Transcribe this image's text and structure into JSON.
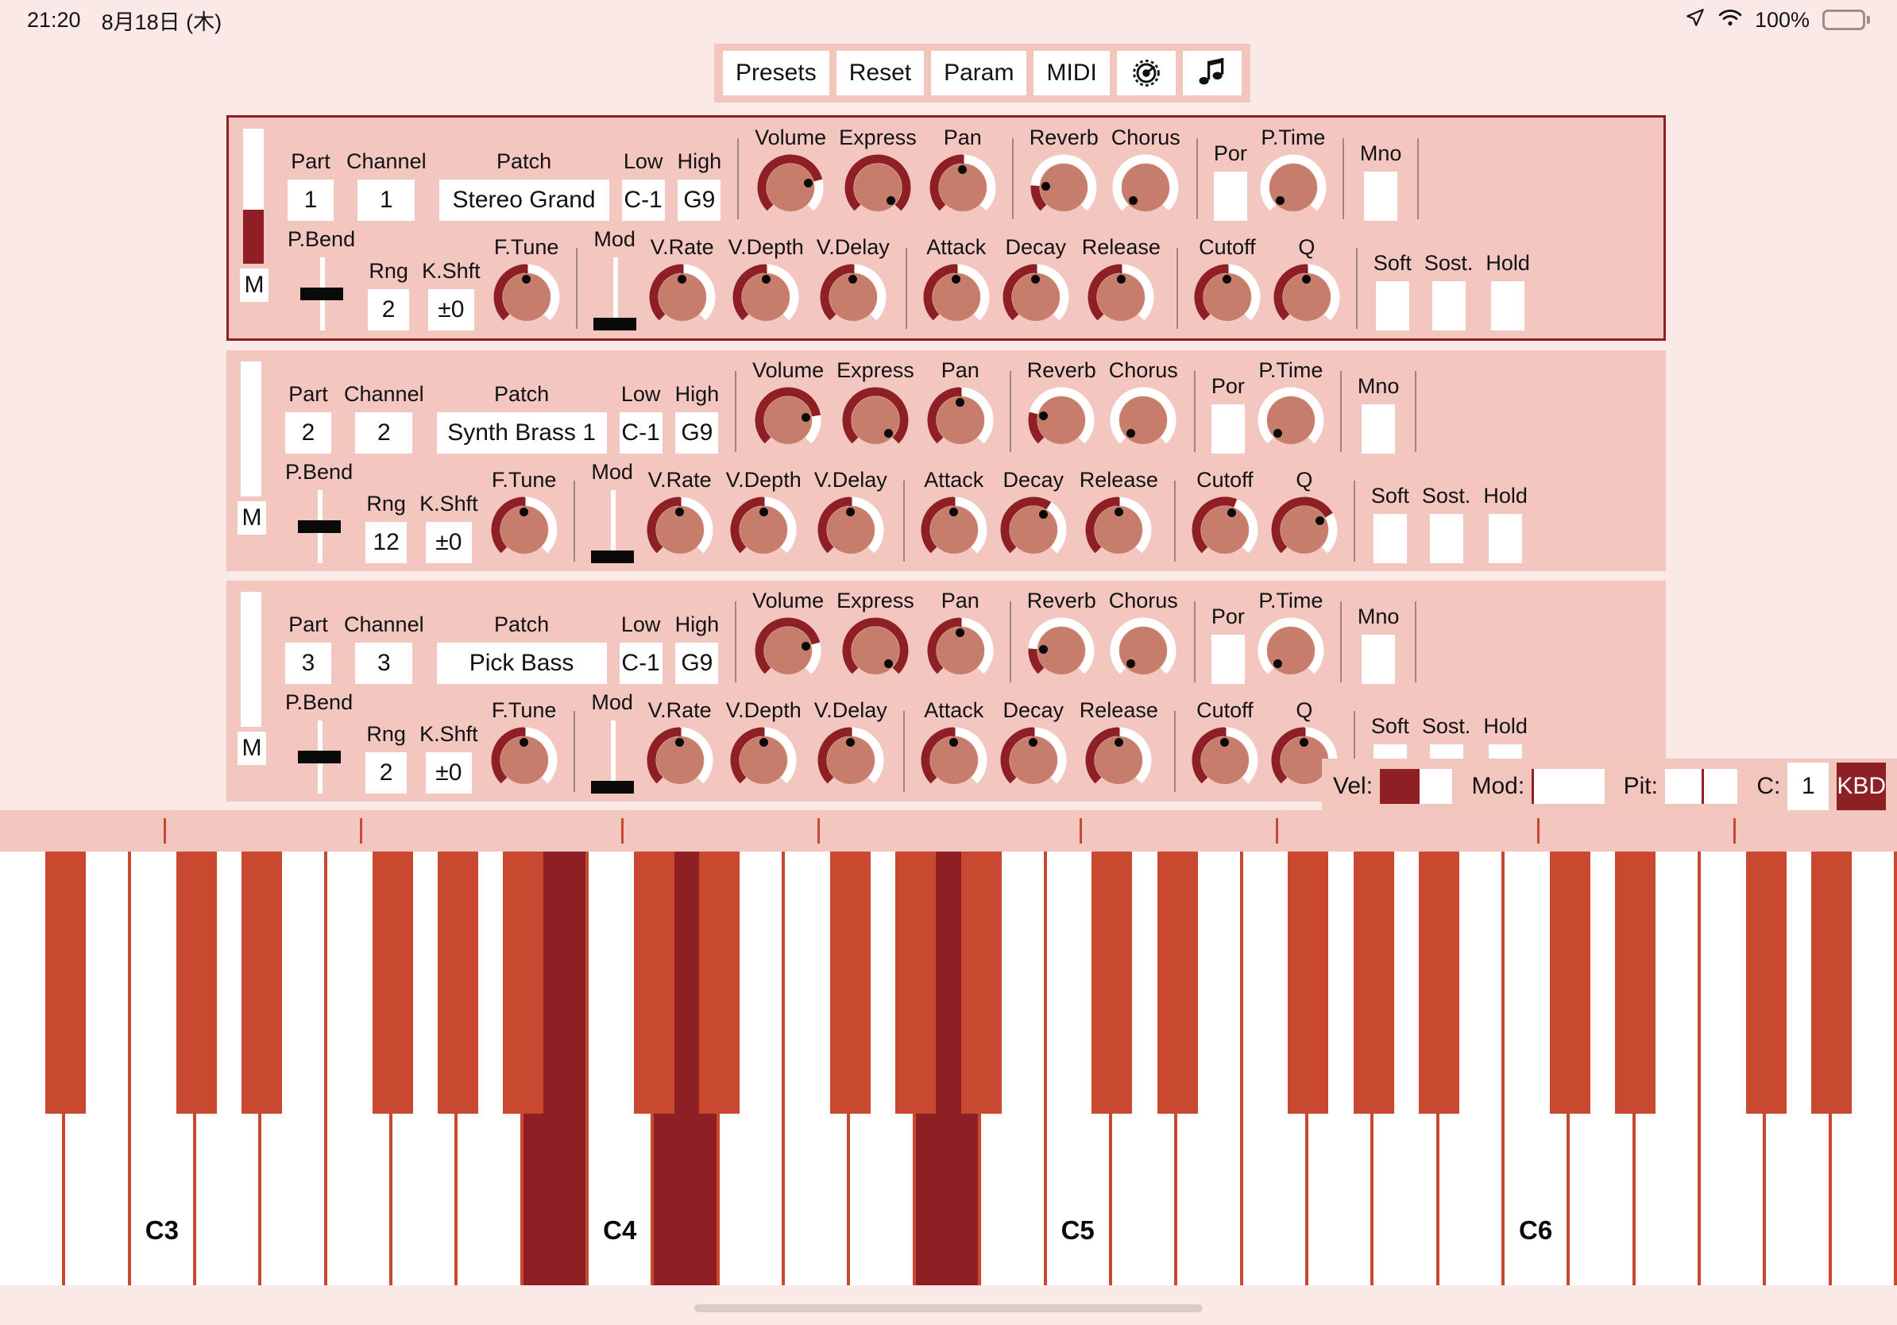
{
  "status_bar": {
    "time": "21:20",
    "date": "8月18日 (木)",
    "battery_percent": "100%",
    "icons": [
      "location-arrow-icon",
      "wifi-icon",
      "battery-icon"
    ]
  },
  "toolbar": {
    "buttons": [
      {
        "label": "Presets",
        "name": "presets-button"
      },
      {
        "label": "Reset",
        "name": "reset-button"
      },
      {
        "label": "Param",
        "name": "param-button"
      },
      {
        "label": "MIDI",
        "name": "midi-button"
      }
    ],
    "icon_buttons": [
      {
        "name": "gear-icon",
        "label": "Settings"
      },
      {
        "name": "music-note-icon",
        "label": "Sound"
      }
    ]
  },
  "labels": {
    "part": "Part",
    "channel": "Channel",
    "patch": "Patch",
    "low": "Low",
    "high": "High",
    "volume": "Volume",
    "express": "Express",
    "pan": "Pan",
    "reverb": "Reverb",
    "chorus": "Chorus",
    "por": "Por",
    "ptime": "P.Time",
    "mno": "Mno",
    "pbend": "P.Bend",
    "rng": "Rng",
    "kshft": "K.Shft",
    "ftune": "F.Tune",
    "mod": "Mod",
    "vrate": "V.Rate",
    "vdepth": "V.Depth",
    "vdelay": "V.Delay",
    "attack": "Attack",
    "decay": "Decay",
    "release": "Release",
    "cutoff": "Cutoff",
    "q": "Q",
    "soft": "Soft",
    "sost": "Sost.",
    "hold": "Hold",
    "mute": "M"
  },
  "parts": [
    {
      "selected": true,
      "meter_level": 40,
      "part": "1",
      "channel": "1",
      "patch": "Stereo Grand",
      "low": "C-1",
      "high": "G9",
      "volume": 0.78,
      "express": 1.0,
      "pan": 0.5,
      "reverb": 0.18,
      "chorus": 0.0,
      "por": false,
      "ptime": 0.0,
      "mno": false,
      "pbend": 0.5,
      "rng": "2",
      "kshft": "±0",
      "ftune": 0.5,
      "mod": 0.0,
      "vrate": 0.5,
      "vdepth": 0.5,
      "vdelay": 0.5,
      "attack": 0.5,
      "decay": 0.5,
      "release": 0.5,
      "cutoff": 0.5,
      "q": 0.5,
      "soft": false,
      "sost": false,
      "hold": false
    },
    {
      "selected": false,
      "meter_level": 0,
      "part": "2",
      "channel": "2",
      "patch": "Synth Brass 1",
      "low": "C-1",
      "high": "G9",
      "volume": 0.8,
      "express": 1.0,
      "pan": 0.5,
      "reverb": 0.22,
      "chorus": 0.0,
      "por": false,
      "ptime": 0.0,
      "mno": false,
      "pbend": 0.5,
      "rng": "12",
      "kshft": "±0",
      "ftune": 0.5,
      "mod": 0.0,
      "vrate": 0.5,
      "vdepth": 0.5,
      "vdelay": 0.5,
      "attack": 0.5,
      "decay": 0.62,
      "release": 0.5,
      "cutoff": 0.58,
      "q": 0.72,
      "soft": false,
      "sost": false,
      "hold": false
    },
    {
      "selected": false,
      "meter_level": 0,
      "part": "3",
      "channel": "3",
      "patch": "Pick Bass",
      "low": "C-1",
      "high": "G9",
      "volume": 0.78,
      "express": 1.0,
      "pan": 0.5,
      "reverb": 0.18,
      "chorus": 0.0,
      "por": false,
      "ptime": 0.0,
      "mno": false,
      "pbend": 0.5,
      "rng": "2",
      "kshft": "±0",
      "ftune": 0.5,
      "mod": 0.0,
      "vrate": 0.5,
      "vdepth": 0.5,
      "vdelay": 0.5,
      "attack": 0.5,
      "decay": 0.5,
      "release": 0.5,
      "cutoff": 0.5,
      "q": 0.5,
      "soft": false,
      "sost": false,
      "hold": false
    }
  ],
  "kbd_bar": {
    "vel_label": "Vel:",
    "vel_value": 0.55,
    "mod_label": "Mod:",
    "mod_value": 0.0,
    "pit_label": "Pit:",
    "pit_value": 0.5,
    "c_label": "C:",
    "c_value": "1",
    "kbd_button": "KBD"
  },
  "keyboard": {
    "octave_labels": [
      "C3",
      "C4",
      "C5",
      "C6"
    ],
    "white_key_count": 29,
    "pressed_white_keys": [
      "B3",
      "D4",
      "A4"
    ],
    "pressed_black_keys": [],
    "colors": {
      "white_key": "#ffffff",
      "black_key": "#c8492f",
      "pressed": "#8d1f25",
      "border": "#c8492f"
    }
  },
  "colors": {
    "background": "#fae9e6",
    "panel": "#f3c7bf",
    "panel_selected_border": "#8d1f25",
    "accent_dark": "#8d1f25",
    "knob_body": "#c77d6c",
    "knob_track": "#ffffff",
    "key_red": "#c8492f"
  }
}
